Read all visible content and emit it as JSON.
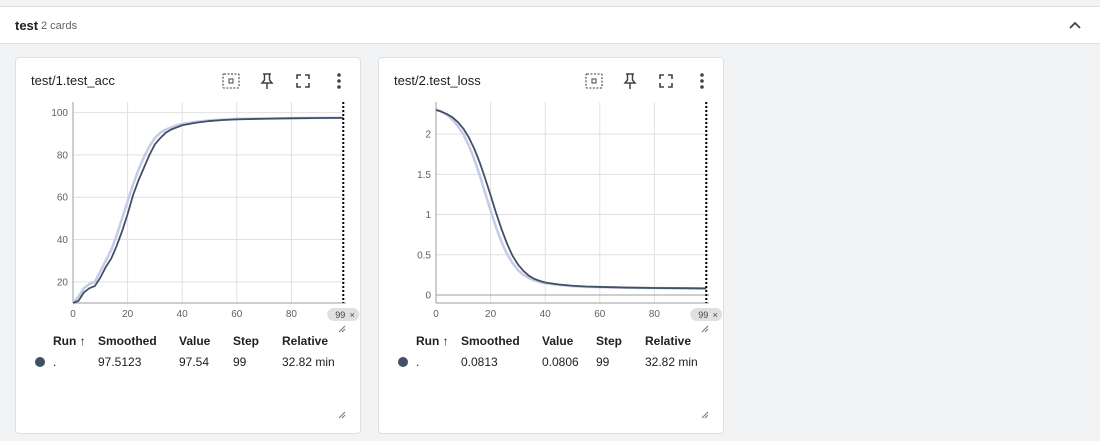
{
  "group": {
    "name": "test",
    "card_count": "2 cards",
    "collapse_icon": "chevron-up-icon"
  },
  "colors": {
    "smoothed_line": "#425066",
    "raw_line": "#c5cae9",
    "grid": "#e0e0e0",
    "step_marker": "#000000"
  },
  "toolbar_icons": [
    "fit-domain-icon",
    "pin-icon",
    "fullscreen-icon",
    "more-vert-icon"
  ],
  "table_headers": {
    "run": "Run ↑",
    "smoothed": "Smoothed",
    "value": "Value",
    "step": "Step",
    "relative": "Relative"
  },
  "cards": [
    {
      "title": "test/1.test_acc",
      "step_chip": "99",
      "chip_close": "×",
      "row": {
        "run": ".",
        "smoothed": "97.5123",
        "value": "97.54",
        "step": "99",
        "relative": "32.82 min"
      },
      "chart_data": {
        "type": "line",
        "title": "test/1.test_acc",
        "xlim": [
          0,
          100
        ],
        "ylim": [
          10,
          105
        ],
        "x_ticks": [
          0,
          20,
          40,
          60,
          80
        ],
        "y_ticks": [
          20,
          40,
          60,
          80,
          100
        ],
        "grid": true,
        "step_marker_x": 99,
        "series": [
          {
            "name": "Smoothed",
            "x": [
              0,
              2,
              4,
              6,
              8,
              10,
              12,
              14,
              16,
              18,
              20,
              22,
              24,
              26,
              28,
              30,
              32,
              34,
              36,
              38,
              40,
              45,
              50,
              55,
              60,
              70,
              80,
              90,
              99
            ],
            "y": [
              10,
              11,
              15,
              17,
              18,
              22,
              27,
              31,
              37,
              44,
              52,
              61,
              68,
              74,
              80,
              85,
              88,
              90.5,
              92,
              93,
              94,
              95.2,
              96,
              96.5,
              96.8,
              97.1,
              97.3,
              97.45,
              97.51
            ]
          },
          {
            "name": "Value",
            "x": [
              0,
              2,
              4,
              6,
              8,
              10,
              12,
              14,
              16,
              18,
              20,
              22,
              24,
              26,
              28,
              30,
              32,
              34,
              36,
              38,
              40,
              45,
              50,
              55,
              60,
              70,
              80,
              90,
              99
            ],
            "y": [
              10,
              13,
              17,
              19,
              20,
              25,
              30,
              35,
              42,
              50,
              58,
              66,
              73,
              79,
              84,
              88,
              90.5,
              92,
              93,
              94,
              94.6,
              95.6,
              96.3,
              96.7,
              97,
              97.2,
              97.4,
              97.5,
              97.54
            ]
          }
        ]
      }
    },
    {
      "title": "test/2.test_loss",
      "step_chip": "99",
      "chip_close": "×",
      "row": {
        "run": ".",
        "smoothed": "0.0813",
        "value": "0.0806",
        "step": "99",
        "relative": "32.82 min"
      },
      "chart_data": {
        "type": "line",
        "title": "test/2.test_loss",
        "xlim": [
          0,
          100
        ],
        "ylim": [
          -0.1,
          2.4
        ],
        "x_ticks": [
          0,
          20,
          40,
          60,
          80
        ],
        "y_ticks": [
          0,
          0.5,
          1,
          1.5,
          2
        ],
        "grid": true,
        "step_marker_x": 99,
        "series": [
          {
            "name": "Smoothed",
            "x": [
              0,
              2,
              4,
              6,
              8,
              10,
              12,
              14,
              16,
              18,
              20,
              22,
              24,
              26,
              28,
              30,
              32,
              34,
              36,
              38,
              40,
              45,
              50,
              55,
              60,
              70,
              80,
              90,
              99
            ],
            "y": [
              2.3,
              2.28,
              2.25,
              2.21,
              2.15,
              2.07,
              1.96,
              1.82,
              1.65,
              1.45,
              1.24,
              1.02,
              0.82,
              0.64,
              0.49,
              0.38,
              0.3,
              0.24,
              0.2,
              0.175,
              0.155,
              0.13,
              0.115,
              0.105,
              0.1,
              0.092,
              0.087,
              0.084,
              0.0813
            ]
          },
          {
            "name": "Value",
            "x": [
              0,
              2,
              4,
              6,
              8,
              10,
              12,
              14,
              16,
              18,
              20,
              22,
              24,
              26,
              28,
              30,
              32,
              34,
              36,
              38,
              40,
              45,
              50,
              55,
              60,
              70,
              80,
              90,
              99
            ],
            "y": [
              2.31,
              2.28,
              2.24,
              2.18,
              2.1,
              2.0,
              1.86,
              1.69,
              1.49,
              1.27,
              1.05,
              0.84,
              0.66,
              0.51,
              0.4,
              0.31,
              0.25,
              0.21,
              0.18,
              0.16,
              0.145,
              0.125,
              0.11,
              0.1,
              0.097,
              0.09,
              0.086,
              0.083,
              0.0806
            ]
          }
        ]
      }
    }
  ]
}
